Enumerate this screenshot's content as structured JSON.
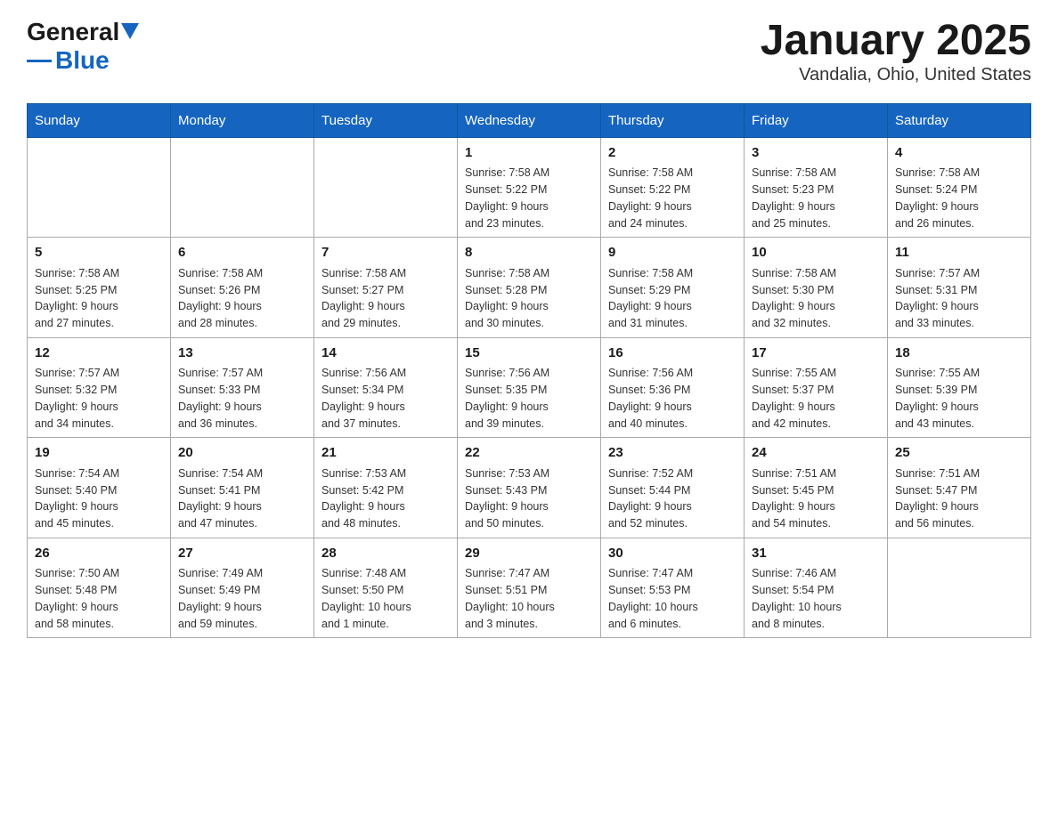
{
  "header": {
    "logo_general": "General",
    "logo_blue": "Blue",
    "title": "January 2025",
    "subtitle": "Vandalia, Ohio, United States"
  },
  "days_of_week": [
    "Sunday",
    "Monday",
    "Tuesday",
    "Wednesday",
    "Thursday",
    "Friday",
    "Saturday"
  ],
  "weeks": [
    [
      {
        "day": "",
        "info": ""
      },
      {
        "day": "",
        "info": ""
      },
      {
        "day": "",
        "info": ""
      },
      {
        "day": "1",
        "info": "Sunrise: 7:58 AM\nSunset: 5:22 PM\nDaylight: 9 hours\nand 23 minutes."
      },
      {
        "day": "2",
        "info": "Sunrise: 7:58 AM\nSunset: 5:22 PM\nDaylight: 9 hours\nand 24 minutes."
      },
      {
        "day": "3",
        "info": "Sunrise: 7:58 AM\nSunset: 5:23 PM\nDaylight: 9 hours\nand 25 minutes."
      },
      {
        "day": "4",
        "info": "Sunrise: 7:58 AM\nSunset: 5:24 PM\nDaylight: 9 hours\nand 26 minutes."
      }
    ],
    [
      {
        "day": "5",
        "info": "Sunrise: 7:58 AM\nSunset: 5:25 PM\nDaylight: 9 hours\nand 27 minutes."
      },
      {
        "day": "6",
        "info": "Sunrise: 7:58 AM\nSunset: 5:26 PM\nDaylight: 9 hours\nand 28 minutes."
      },
      {
        "day": "7",
        "info": "Sunrise: 7:58 AM\nSunset: 5:27 PM\nDaylight: 9 hours\nand 29 minutes."
      },
      {
        "day": "8",
        "info": "Sunrise: 7:58 AM\nSunset: 5:28 PM\nDaylight: 9 hours\nand 30 minutes."
      },
      {
        "day": "9",
        "info": "Sunrise: 7:58 AM\nSunset: 5:29 PM\nDaylight: 9 hours\nand 31 minutes."
      },
      {
        "day": "10",
        "info": "Sunrise: 7:58 AM\nSunset: 5:30 PM\nDaylight: 9 hours\nand 32 minutes."
      },
      {
        "day": "11",
        "info": "Sunrise: 7:57 AM\nSunset: 5:31 PM\nDaylight: 9 hours\nand 33 minutes."
      }
    ],
    [
      {
        "day": "12",
        "info": "Sunrise: 7:57 AM\nSunset: 5:32 PM\nDaylight: 9 hours\nand 34 minutes."
      },
      {
        "day": "13",
        "info": "Sunrise: 7:57 AM\nSunset: 5:33 PM\nDaylight: 9 hours\nand 36 minutes."
      },
      {
        "day": "14",
        "info": "Sunrise: 7:56 AM\nSunset: 5:34 PM\nDaylight: 9 hours\nand 37 minutes."
      },
      {
        "day": "15",
        "info": "Sunrise: 7:56 AM\nSunset: 5:35 PM\nDaylight: 9 hours\nand 39 minutes."
      },
      {
        "day": "16",
        "info": "Sunrise: 7:56 AM\nSunset: 5:36 PM\nDaylight: 9 hours\nand 40 minutes."
      },
      {
        "day": "17",
        "info": "Sunrise: 7:55 AM\nSunset: 5:37 PM\nDaylight: 9 hours\nand 42 minutes."
      },
      {
        "day": "18",
        "info": "Sunrise: 7:55 AM\nSunset: 5:39 PM\nDaylight: 9 hours\nand 43 minutes."
      }
    ],
    [
      {
        "day": "19",
        "info": "Sunrise: 7:54 AM\nSunset: 5:40 PM\nDaylight: 9 hours\nand 45 minutes."
      },
      {
        "day": "20",
        "info": "Sunrise: 7:54 AM\nSunset: 5:41 PM\nDaylight: 9 hours\nand 47 minutes."
      },
      {
        "day": "21",
        "info": "Sunrise: 7:53 AM\nSunset: 5:42 PM\nDaylight: 9 hours\nand 48 minutes."
      },
      {
        "day": "22",
        "info": "Sunrise: 7:53 AM\nSunset: 5:43 PM\nDaylight: 9 hours\nand 50 minutes."
      },
      {
        "day": "23",
        "info": "Sunrise: 7:52 AM\nSunset: 5:44 PM\nDaylight: 9 hours\nand 52 minutes."
      },
      {
        "day": "24",
        "info": "Sunrise: 7:51 AM\nSunset: 5:45 PM\nDaylight: 9 hours\nand 54 minutes."
      },
      {
        "day": "25",
        "info": "Sunrise: 7:51 AM\nSunset: 5:47 PM\nDaylight: 9 hours\nand 56 minutes."
      }
    ],
    [
      {
        "day": "26",
        "info": "Sunrise: 7:50 AM\nSunset: 5:48 PM\nDaylight: 9 hours\nand 58 minutes."
      },
      {
        "day": "27",
        "info": "Sunrise: 7:49 AM\nSunset: 5:49 PM\nDaylight: 9 hours\nand 59 minutes."
      },
      {
        "day": "28",
        "info": "Sunrise: 7:48 AM\nSunset: 5:50 PM\nDaylight: 10 hours\nand 1 minute."
      },
      {
        "day": "29",
        "info": "Sunrise: 7:47 AM\nSunset: 5:51 PM\nDaylight: 10 hours\nand 3 minutes."
      },
      {
        "day": "30",
        "info": "Sunrise: 7:47 AM\nSunset: 5:53 PM\nDaylight: 10 hours\nand 6 minutes."
      },
      {
        "day": "31",
        "info": "Sunrise: 7:46 AM\nSunset: 5:54 PM\nDaylight: 10 hours\nand 8 minutes."
      },
      {
        "day": "",
        "info": ""
      }
    ]
  ]
}
